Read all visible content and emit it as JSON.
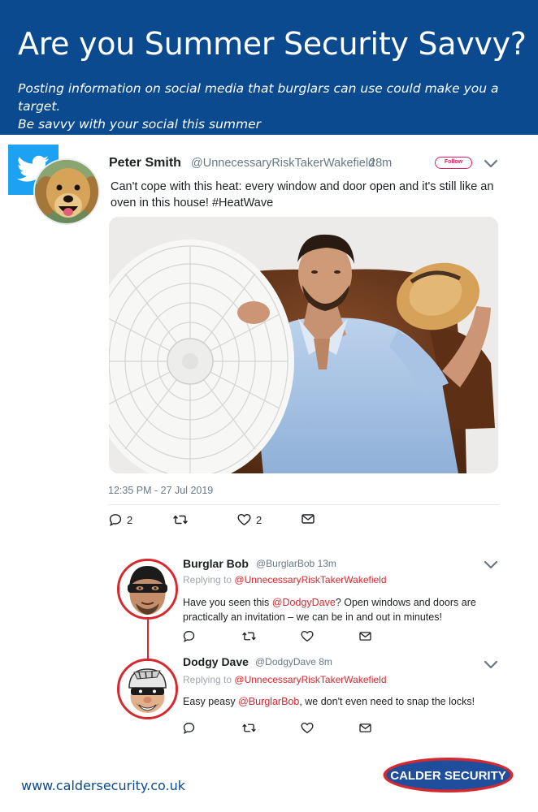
{
  "banner": {
    "title": "Are you Summer Security Savvy?",
    "subtitle_line1": "Posting information on social media that burglars can use could make you a target.",
    "subtitle_line2": "Be savvy with your social this summer",
    "background": "#0b4a8f"
  },
  "tweet": {
    "name": "Peter Smith",
    "handle": "@UnnecessaryRiskTakerWakefield",
    "time": "28m",
    "follow_label": "Follow",
    "text": "Can't cope with this heat: every window and door open and it's still like an oven in this house! #HeatWave",
    "date": "12:35 PM - 27 Jul 2019",
    "replies": "2",
    "likes": "2",
    "avatar_icon": "dog-avatar",
    "logo_icon": "twitter-bird-icon"
  },
  "replies": [
    {
      "name": "Burglar Bob",
      "handle": "@BurglarBob",
      "time": "13m",
      "replying_prefix": "Replying to",
      "replying_to": "@UnnecessaryRiskTakerWakefield",
      "text_before": "Have you seen this ",
      "mention": "@DodgyDave",
      "text_after": "? Open windows and doors are practically an invitation – we can be in and out in minutes!"
    },
    {
      "name": "Dodgy Dave",
      "handle": "@DodgyDave",
      "time": "8m",
      "replying_prefix": "Replying to",
      "replying_to": "@UnnecessaryRiskTakerWakefield",
      "text_before": "Easy peasy ",
      "mention": "@BurglarBob",
      "text_after": ", we don't even need to snap the locks!"
    }
  ],
  "footer": {
    "url": "www.caldersecurity.co.uk",
    "logo_text": "CALDER SECURITY"
  },
  "colors": {
    "brand_blue": "#0b4a8f",
    "accent_red": "#d7282f",
    "twitter_blue": "#1da1f2",
    "muted_gray": "#697882"
  }
}
